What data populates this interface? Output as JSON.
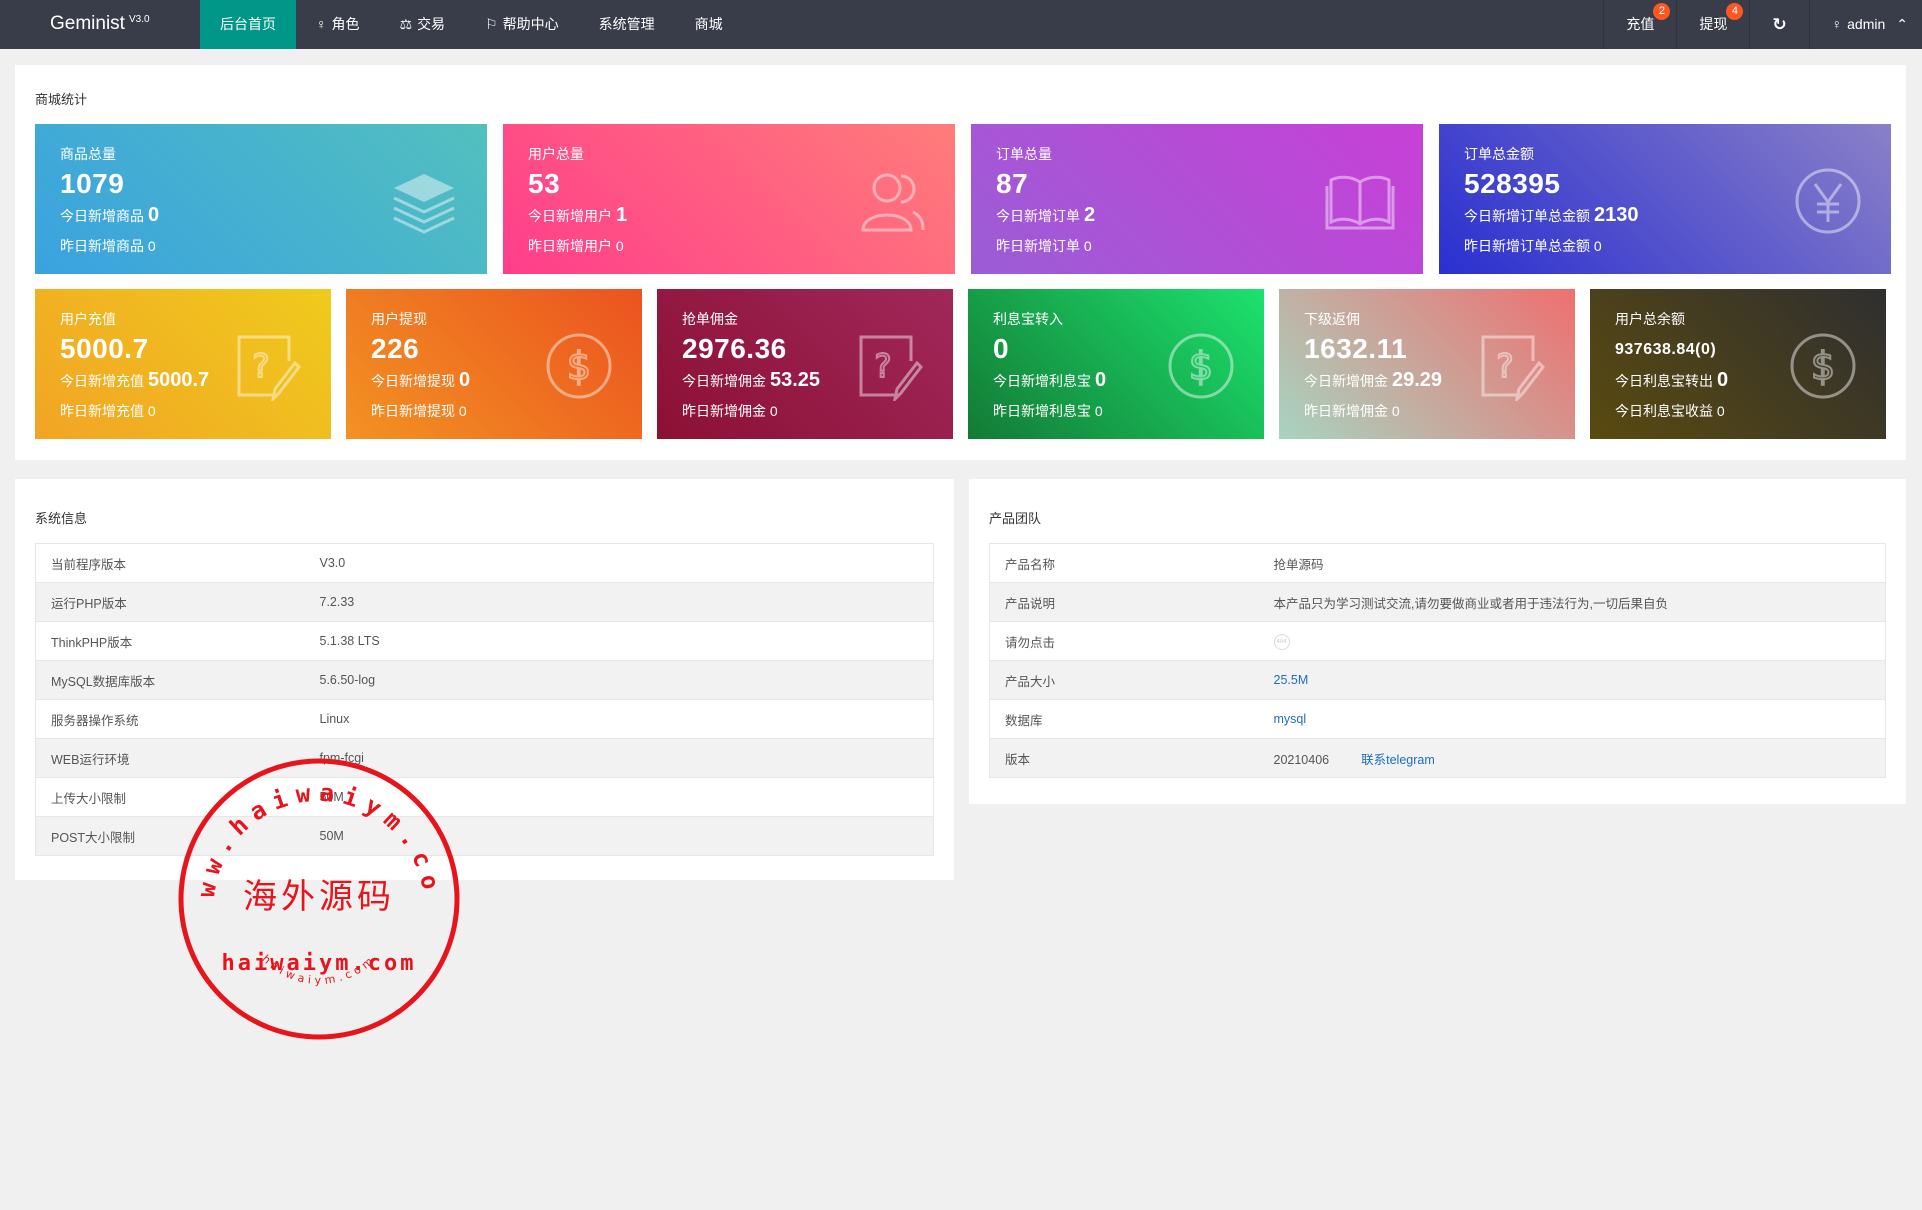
{
  "nav": {
    "logo": "Geminist",
    "version": "V3.0",
    "menu": [
      {
        "label": "后台首页",
        "icon": "home"
      },
      {
        "label": "角色",
        "icon": "user-icon"
      },
      {
        "label": "交易",
        "icon": "scale-icon"
      },
      {
        "label": "帮助中心",
        "icon": "flag-icon"
      },
      {
        "label": "系统管理",
        "icon": ""
      },
      {
        "label": "商城",
        "icon": ""
      }
    ],
    "recharge": {
      "label": "充值",
      "badge": "2"
    },
    "withdraw": {
      "label": "提现",
      "badge": "4"
    },
    "user": "admin"
  },
  "stats": {
    "title": "商城统计",
    "cards": [
      {
        "title": "商品总量",
        "value": "1079",
        "s1_label": "今日新增商品",
        "s1_value": "0",
        "s2": "昨日新增商品 0",
        "icon": "layers-icon",
        "colors": [
          "#3aa2e0",
          "#52c0bf"
        ]
      },
      {
        "title": "用户总量",
        "value": "53",
        "s1_label": "今日新增用户",
        "s1_value": "1",
        "s2": "昨日新增用户 0",
        "icon": "users-icon",
        "colors": [
          "#ff3d8b",
          "#ff7d7a"
        ]
      },
      {
        "title": "订单总量",
        "value": "87",
        "s1_label": "今日新增订单",
        "s1_value": "2",
        "s2": "昨日新增订单 0",
        "icon": "book-icon",
        "colors": [
          "#9b5dd6",
          "#c840d7"
        ]
      },
      {
        "title": "订单总金额",
        "value": "528395",
        "s1_label": "今日新增订单总金额",
        "s1_value": "2130",
        "s2": "昨日新增订单总金额 0",
        "icon": "yen-icon",
        "colors": [
          "#2a2fd0",
          "#8a80c8"
        ]
      },
      {
        "title": "用户充值",
        "value": "5000.7",
        "s1_label": "今日新增充值",
        "s1_value": "5000.7",
        "s2": "昨日新增充值 0",
        "icon": "help-edit-icon",
        "colors": [
          "#f2a425",
          "#efcb1c"
        ]
      },
      {
        "title": "用户提现",
        "value": "226",
        "s1_label": "今日新增提现",
        "s1_value": "0",
        "s2": "昨日新增提现 0",
        "icon": "dollar-icon",
        "colors": [
          "#f39223",
          "#eb531f"
        ]
      },
      {
        "title": "抢单佣金",
        "value": "2976.36",
        "s1_label": "今日新增佣金",
        "s1_value": "53.25",
        "s2": "昨日新增佣金 0",
        "icon": "help-edit-icon",
        "colors": [
          "#8c1035",
          "#a0285a"
        ]
      },
      {
        "title": "利息宝转入",
        "value": "0",
        "s1_label": "今日新增利息宝",
        "s1_value": "0",
        "s2": "昨日新增利息宝 0",
        "icon": "dollar-icon",
        "colors": [
          "#137a34",
          "#1ce26e"
        ]
      },
      {
        "title": "下级返佣",
        "value": "1632.11",
        "s1_label": "今日新增佣金",
        "s1_value": "29.29",
        "s2": "昨日新增佣金 0",
        "icon": "help-edit-icon",
        "colors": [
          "#a7d4c0",
          "#ef7070"
        ]
      },
      {
        "title": "用户总余额",
        "value": "937638.84(0)",
        "s1_label": "今日利息宝转出",
        "s1_value": "0",
        "s2": "今日利息宝收益 0",
        "icon": "dollar-icon",
        "colors": [
          "#5a4a10",
          "#2f2f2f"
        ]
      }
    ]
  },
  "sysinfo": {
    "title": "系统信息",
    "rows": [
      [
        "当前程序版本",
        "V3.0"
      ],
      [
        "运行PHP版本",
        "7.2.33"
      ],
      [
        "ThinkPHP版本",
        "5.1.38 LTS"
      ],
      [
        "MySQL数据库版本",
        "5.6.50-log"
      ],
      [
        "服务器操作系统",
        "Linux"
      ],
      [
        "WEB运行环境",
        "fpm-fcgi"
      ],
      [
        "上传大小限制",
        "50M"
      ],
      [
        "POST大小限制",
        "50M"
      ]
    ]
  },
  "team": {
    "title": "产品团队",
    "rows": [
      [
        "产品名称",
        "抢单源码"
      ],
      [
        "产品说明",
        "本产品只为学习测试交流,请勿要做商业或者用于违法行为,一切后果自负"
      ],
      [
        "请勿点击",
        ""
      ],
      [
        "产品大小",
        "25.5M"
      ],
      [
        "数据库",
        "mysql"
      ],
      [
        "版本",
        "20210406"
      ]
    ],
    "contact": "联系telegram"
  },
  "watermark": {
    "top": "www.haiwaiym.com",
    "center": "海外源码",
    "bottom": "haiwaiym.com",
    "small": "haiwaiym.com",
    "color": "#e8141b"
  }
}
